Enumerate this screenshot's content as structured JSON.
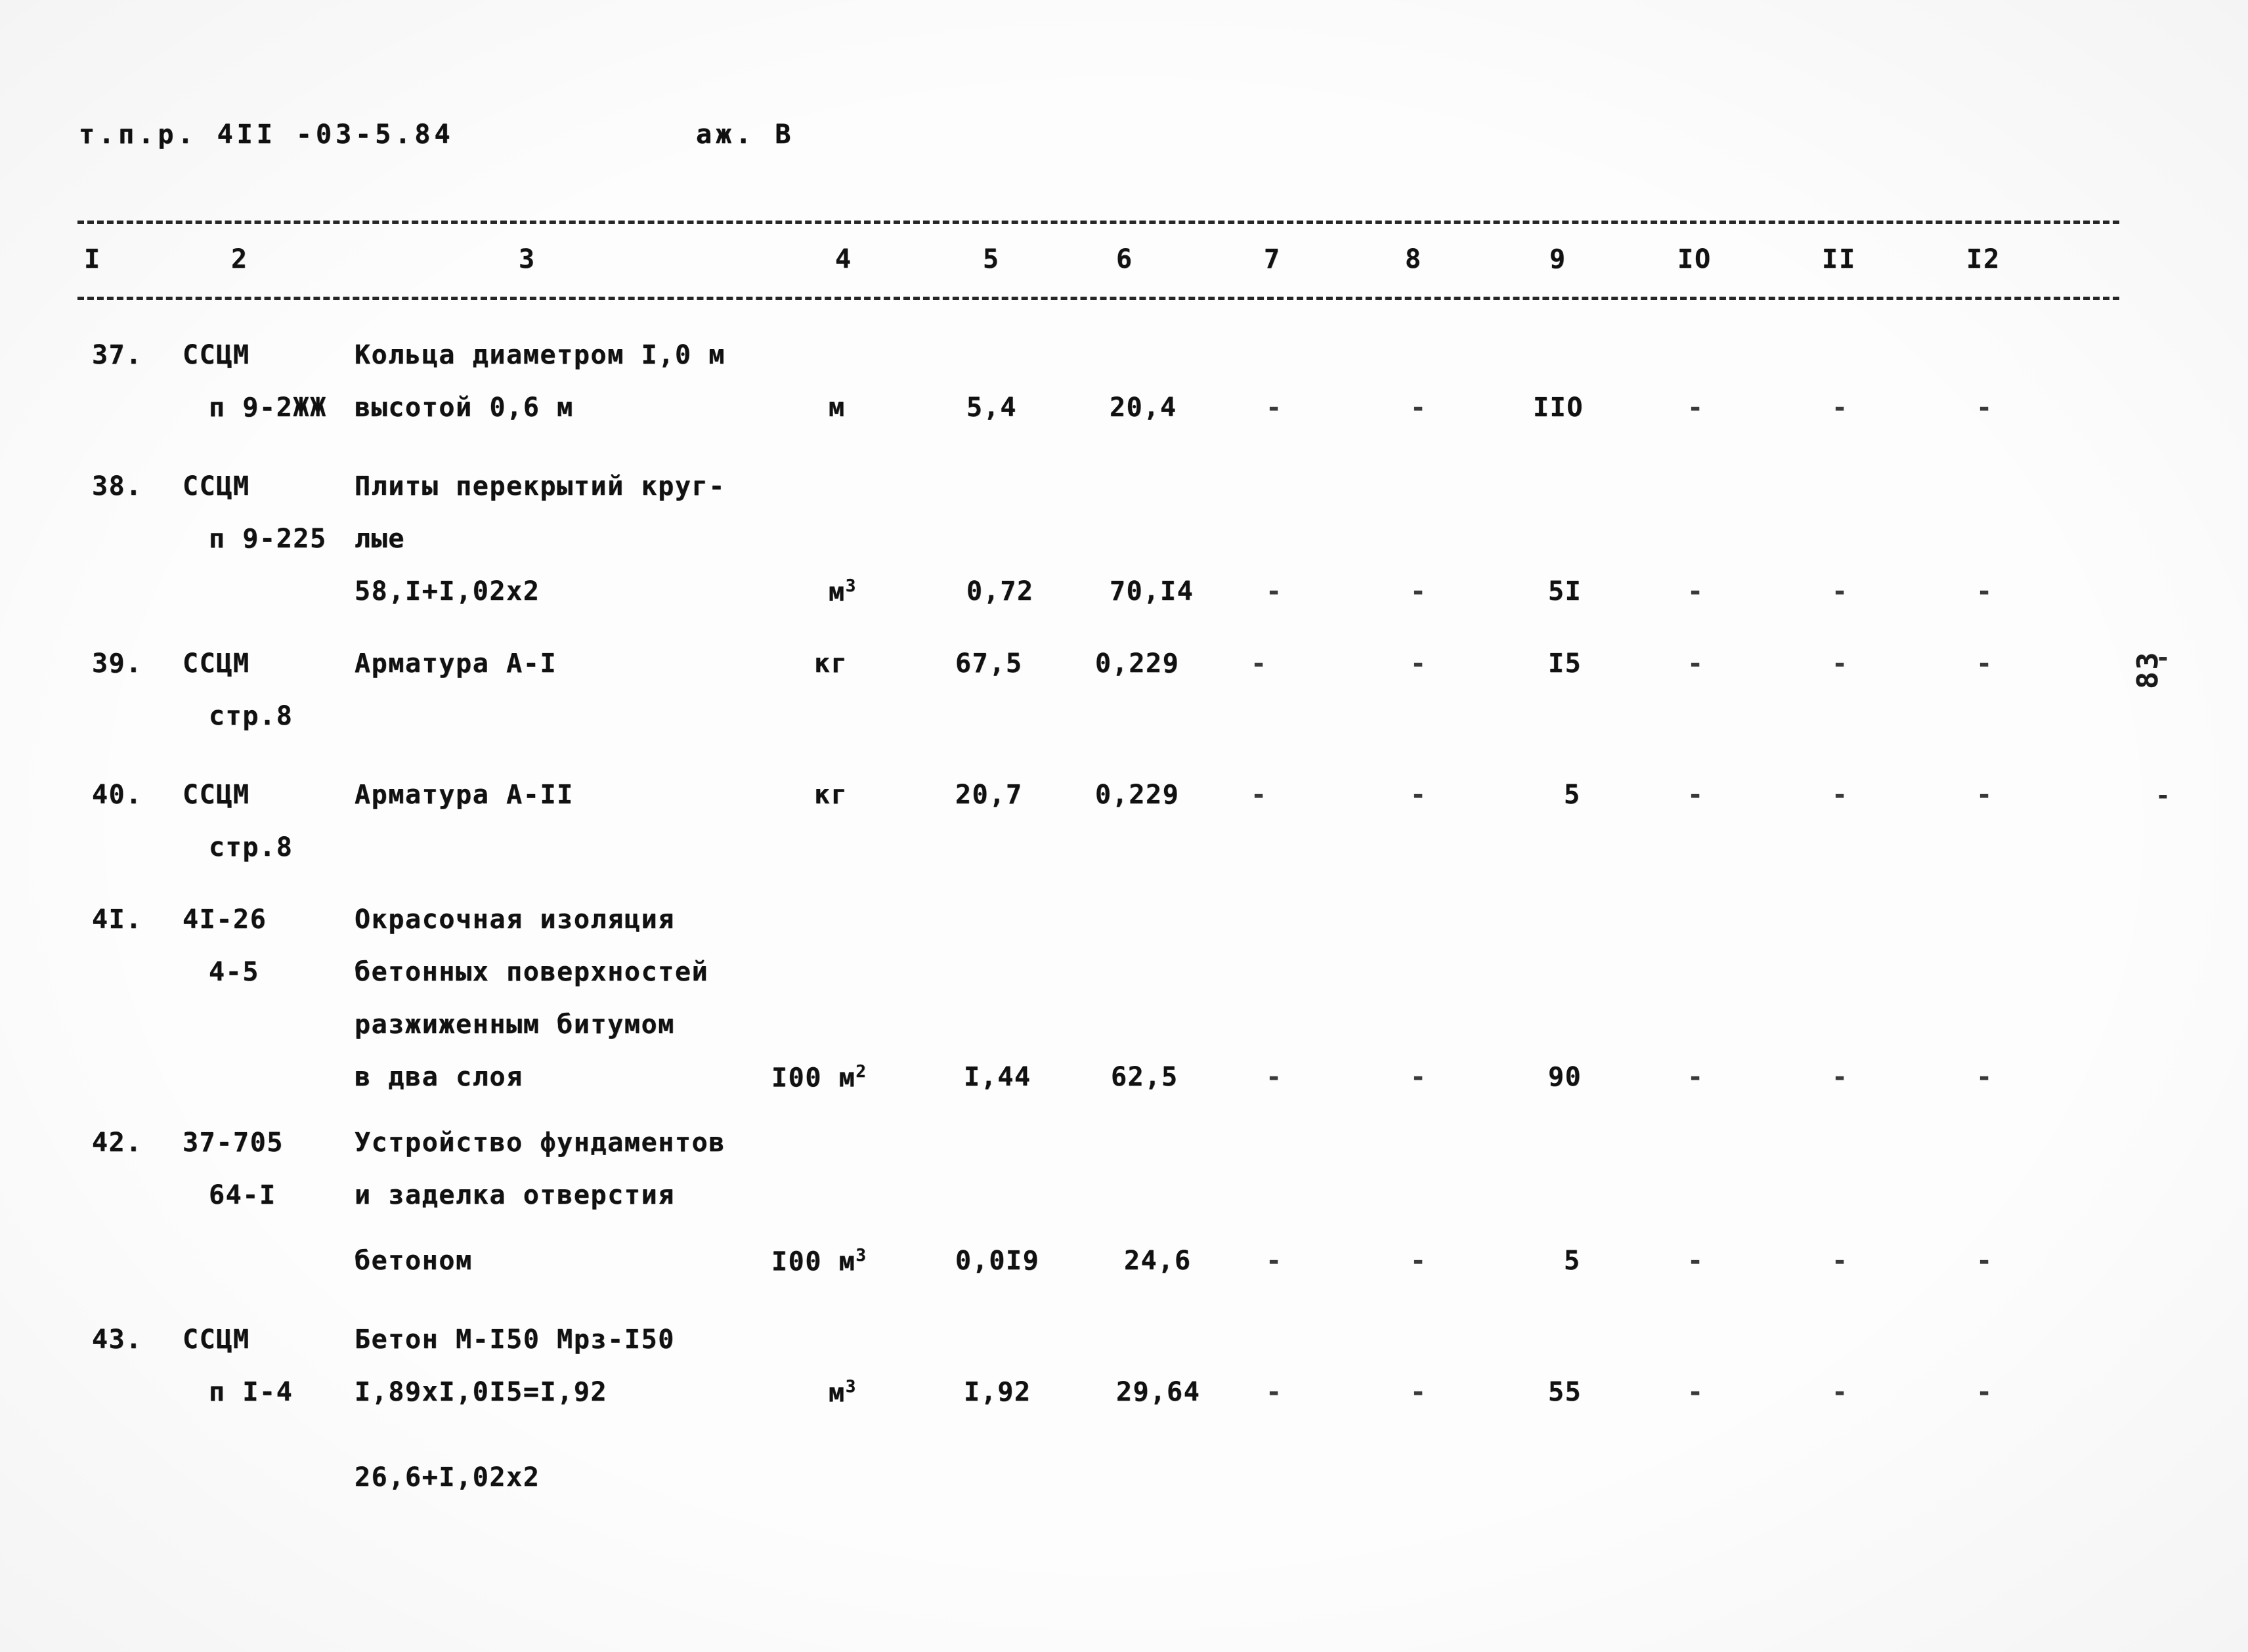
{
  "document": {
    "header_left": "т.п.р. 4II -03-5.84",
    "header_sheet": "аж. В",
    "folio": "83",
    "edge_tick_top": "-",
    "edge_tick_bottom": "-"
  },
  "table": {
    "column_numbers": [
      "I",
      "2",
      "3",
      "4",
      "5",
      "6",
      "7",
      "8",
      "9",
      "IO",
      "II",
      "I2"
    ],
    "rows": [
      {
        "no": "37.",
        "code_line1": "ССЦМ",
        "code_line2": "п 9-2ЖЖ",
        "desc": [
          "Кольца диаметром I,0 м",
          "высотой 0,6 м"
        ],
        "unit": "м",
        "qty": "5,4",
        "price": "20,4",
        "c7": "-",
        "c8": "-",
        "c9": "IIO",
        "c10": "-",
        "c11": "-",
        "c12": "-"
      },
      {
        "no": "38.",
        "code_line1": "ССЦМ",
        "code_line2": "п 9-225",
        "desc": [
          "Плиты перекрытий круг-",
          "лые",
          "58,I+I,02x2"
        ],
        "unit": "м",
        "unit_sup": "3",
        "qty": "0,72",
        "price": "70,I4",
        "c7": "-",
        "c8": "-",
        "c9": "5I",
        "c10": "-",
        "c11": "-",
        "c12": "-"
      },
      {
        "no": "39.",
        "code_line1": "ССЦМ",
        "code_line2": "стр.8",
        "desc": [
          "Арматура А-I"
        ],
        "unit": "кг",
        "qty": "67,5",
        "price": "0,229",
        "c7": "-",
        "c8": "-",
        "c9": "I5",
        "c10": "-",
        "c11": "-",
        "c12": "-"
      },
      {
        "no": "40.",
        "code_line1": "ССЦМ",
        "code_line2": "стр.8",
        "desc": [
          "Арматура А-II"
        ],
        "unit": "кг",
        "qty": "20,7",
        "price": "0,229",
        "c7": "-",
        "c8": "-",
        "c9": "5",
        "c10": "-",
        "c11": "-",
        "c12": "-"
      },
      {
        "no": "4I.",
        "code_line1": "4I-26",
        "code_line2": "4-5",
        "desc": [
          "Окрасочная изоляция",
          "бетонных поверхностей",
          "разжиженным битумом",
          "в два слоя"
        ],
        "unit": "I00 м",
        "unit_sup": "2",
        "qty": "I,44",
        "price": "62,5",
        "c7": "-",
        "c8": "-",
        "c9": "90",
        "c10": "-",
        "c11": "-",
        "c12": "-"
      },
      {
        "no": "42.",
        "code_line1": "37-705",
        "code_line2": "64-I",
        "desc": [
          "Устройство фундаментов",
          "и заделка отверстия",
          "бетоном"
        ],
        "unit": "I00 м",
        "unit_sup": "3",
        "qty": "0,0I9",
        "price": "24,6",
        "c7": "-",
        "c8": "-",
        "c9": "5",
        "c10": "-",
        "c11": "-",
        "c12": "-"
      },
      {
        "no": "43.",
        "code_line1": "ССЦМ",
        "code_line2": "п I-4",
        "desc": [
          "Бетон М-I50 Мрз-I50",
          "I,89хI,0I5=I,92",
          "26,6+I,02х2"
        ],
        "unit": "м",
        "unit_sup": "3",
        "qty": "I,92",
        "price": "29,64",
        "c7": "-",
        "c8": "-",
        "c9": "55",
        "c10": "-",
        "c11": "-",
        "c12": "-"
      }
    ]
  }
}
